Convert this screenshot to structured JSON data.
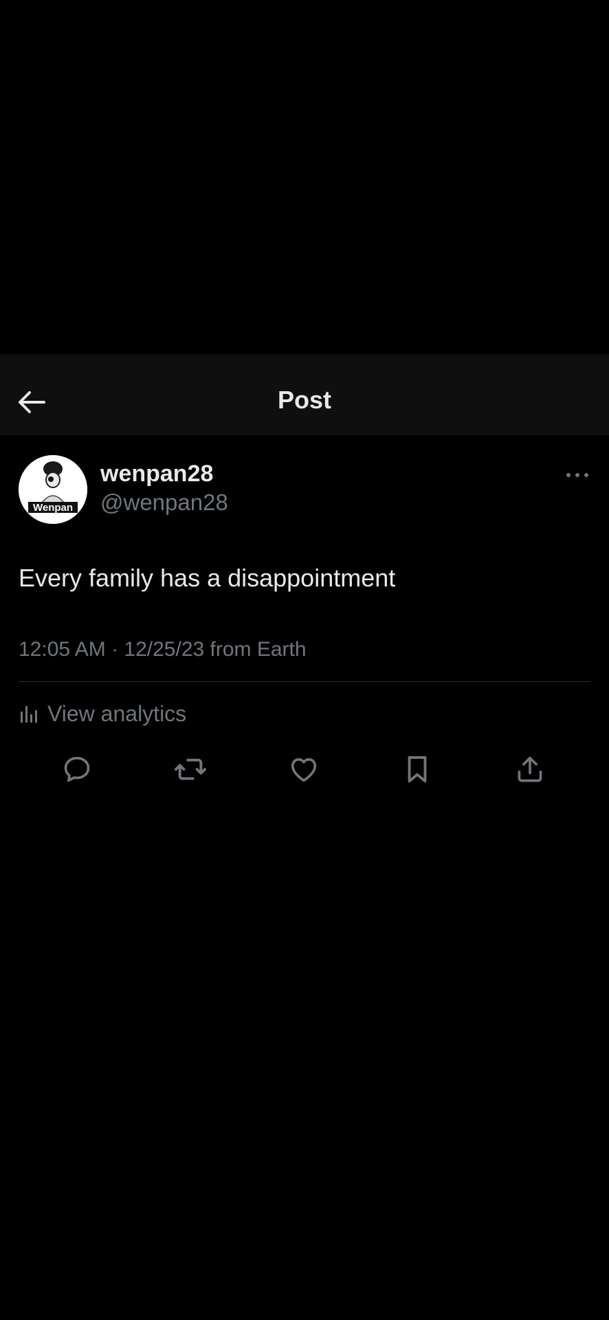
{
  "header": {
    "back_icon": "arrow-left-icon",
    "title": "Post"
  },
  "post": {
    "author_name": "wenpan28",
    "author_handle": "@wenpan28",
    "avatar_text": "Wenpan",
    "text": "Every family has a disappointment",
    "meta": "12:05 AM · 12/25/23 from Earth",
    "analytics_label": "View analytics"
  },
  "actions": [
    "reply-icon",
    "repost-icon",
    "like-icon",
    "bookmark-icon",
    "share-icon"
  ],
  "colors": {
    "background": "#000000",
    "header_bg": "#0f0f0f",
    "primary_text": "#e7e9ea",
    "secondary_text": "#71767b",
    "divider": "#2f3336"
  }
}
